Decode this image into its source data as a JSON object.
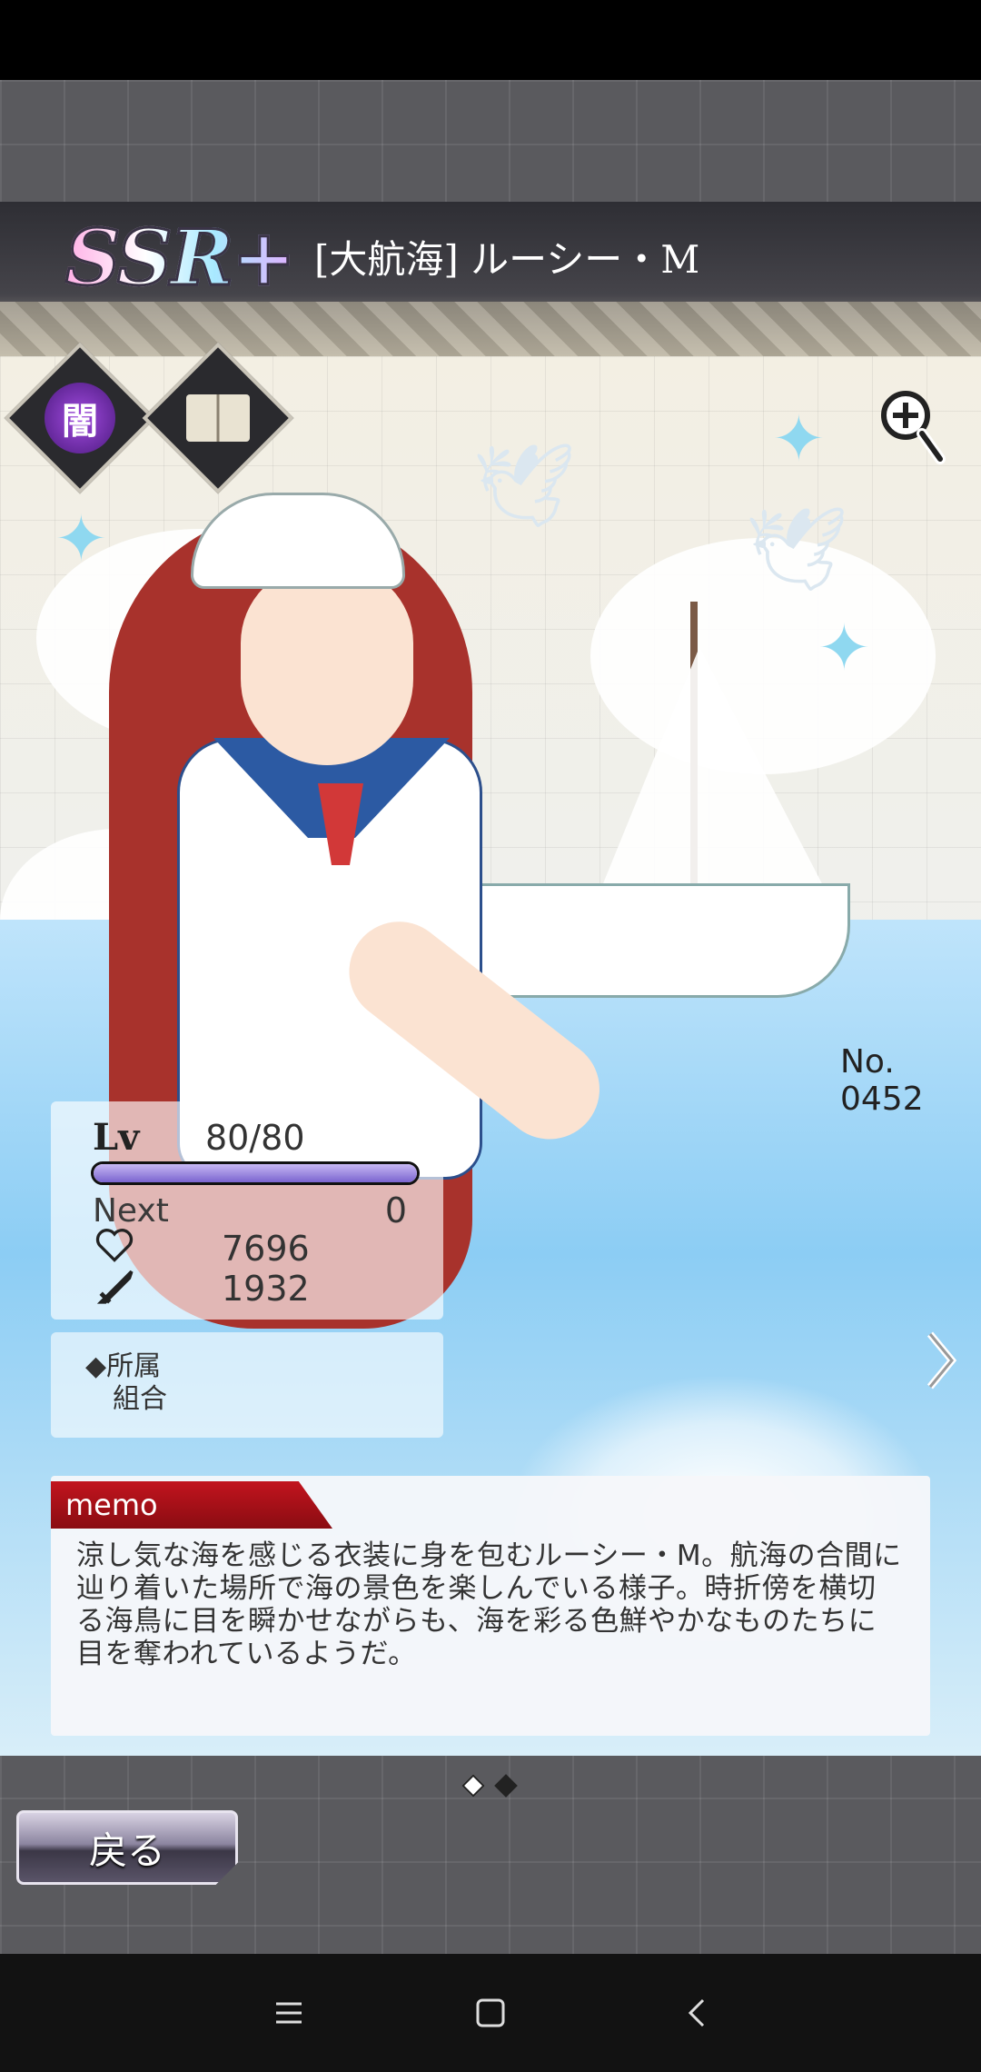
{
  "card": {
    "rarity": "SSR+",
    "name": "[大航海] ルーシー・M",
    "attribute_glyph": "闇",
    "number": "No. 0452"
  },
  "stats": {
    "lv_label": "Lv",
    "lv_value": "80/80",
    "exp_fill_fraction": 1.0,
    "next_label": "Next",
    "next_value": "0",
    "hp_value": "7696",
    "atk_value": "1932"
  },
  "affiliation": {
    "label": "◆所属",
    "value": "組合"
  },
  "memo": {
    "tab_label": "memo",
    "text": "涼し気な海を感じる衣装に身を包むルーシー・M。航海の合間に辿り着いた場所で海の景色を楽しんでいる様子。時折傍を横切る海鳥に目を瞬かせながらも、海を彩る色鮮やかなものたちに目を奪われているようだ。"
  },
  "pagination": {
    "current": 1,
    "total": 2
  },
  "buttons": {
    "back_label": "戻る"
  },
  "icons": [
    "dark-attribute-icon",
    "book-icon",
    "zoom-in-icon",
    "next-arrow-icon",
    "heart-icon",
    "sword-icon",
    "menu-icon",
    "home-icon",
    "back-icon"
  ]
}
